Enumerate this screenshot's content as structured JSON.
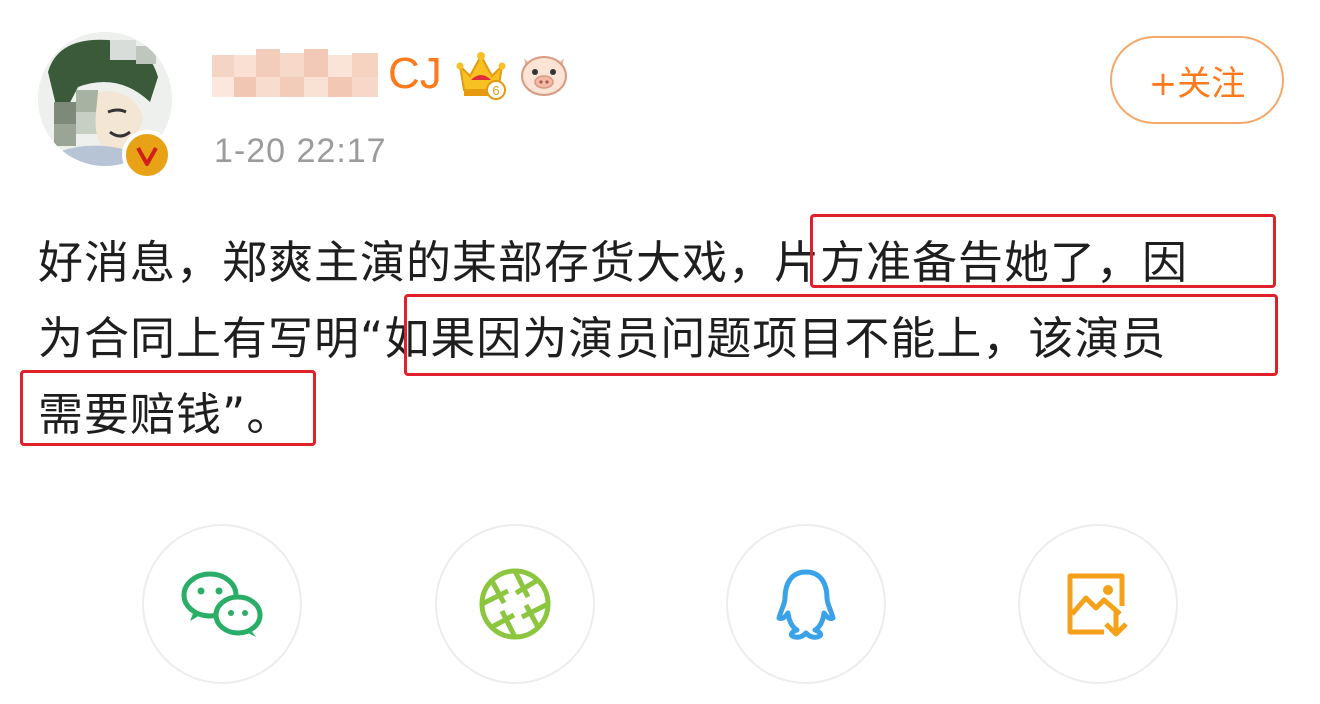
{
  "user": {
    "name_visible": "CJ",
    "avatar_icon": "avatar-image",
    "verified_icon": "verified-v-badge-icon",
    "crown_icon": "vip-crown-icon",
    "badge_icon": "pig-emoji-badge-icon",
    "crown_level": "6"
  },
  "post": {
    "timestamp": "1-20 22:17",
    "lines": [
      "好消息，郑爽主演的某部存货大戏，片方准备告她了，因",
      "为合同上有写明“如果因为演员问题项目不能上，该演员",
      "需要赔钱”。"
    ]
  },
  "follow": {
    "label": "+关注",
    "color": "#ff7a1c"
  },
  "share": {
    "items": [
      {
        "icon": "wechat-icon",
        "color": "#2aae67"
      },
      {
        "icon": "moments-icon",
        "color": "#8cc63f"
      },
      {
        "icon": "qq-icon",
        "color": "#3aa2e8"
      },
      {
        "icon": "save-image-icon",
        "color": "#f5a21a"
      }
    ]
  },
  "highlight_color": "#e0202a"
}
